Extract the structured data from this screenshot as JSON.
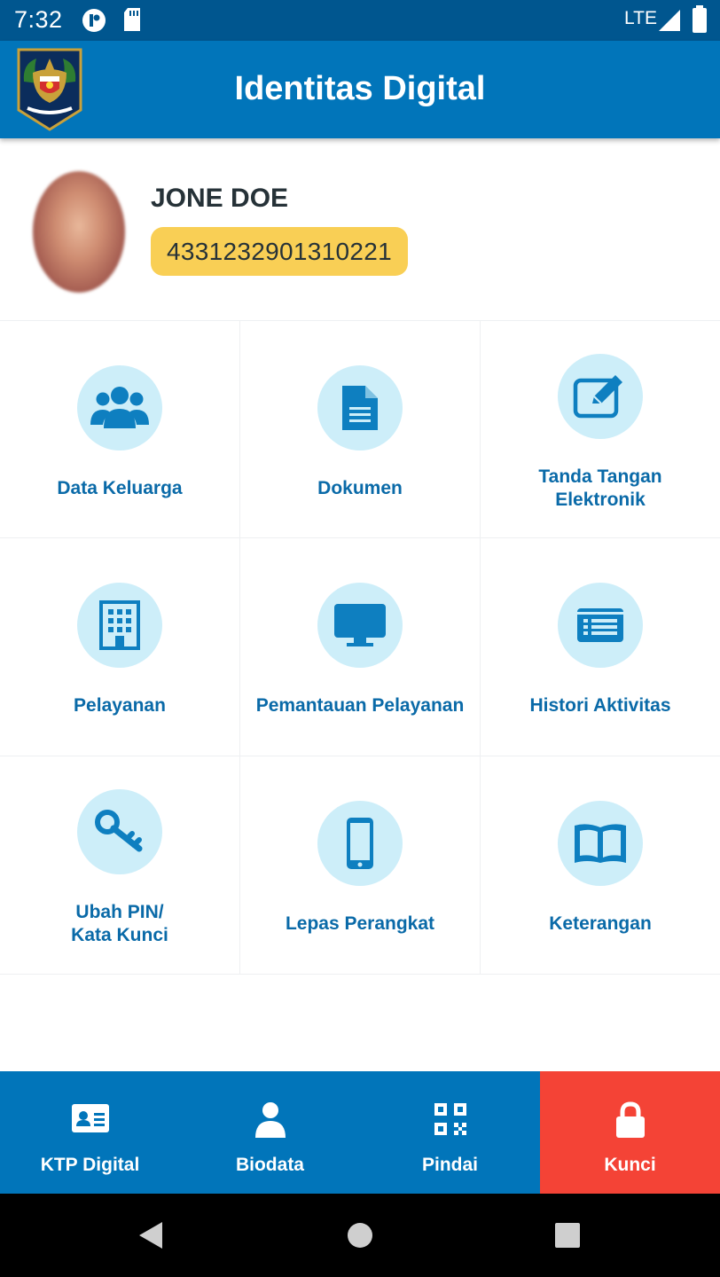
{
  "status_bar": {
    "time": "7:32",
    "network": "LTE"
  },
  "app_bar": {
    "title": "Identitas Digital",
    "logo_icon": "garuda-emblem-icon"
  },
  "profile": {
    "name": "JONE DOE",
    "nik": "4331232901310221"
  },
  "menu": {
    "items": [
      {
        "label": "Data Keluarga",
        "icon": "users-icon"
      },
      {
        "label": "Dokumen",
        "icon": "document-icon"
      },
      {
        "label": "Tanda Tangan\nElektronik",
        "icon": "edit-icon"
      },
      {
        "label": "Pelayanan",
        "icon": "building-icon"
      },
      {
        "label": "Pemantauan Pelayanan",
        "icon": "monitor-icon"
      },
      {
        "label": "Histori Aktivitas",
        "icon": "list-icon"
      },
      {
        "label": "Ubah PIN/\nKata Kunci",
        "icon": "key-icon"
      },
      {
        "label": "Lepas Perangkat",
        "icon": "phone-icon"
      },
      {
        "label": "Keterangan",
        "icon": "book-icon"
      }
    ]
  },
  "bottom_nav": {
    "items": [
      {
        "label": "KTP Digital",
        "icon": "id-card-icon"
      },
      {
        "label": "Biodata",
        "icon": "person-icon"
      },
      {
        "label": "Pindai",
        "icon": "qr-code-icon"
      },
      {
        "label": "Kunci",
        "icon": "lock-icon"
      }
    ],
    "active_color": "#f44336"
  },
  "colors": {
    "primary": "#0175ba",
    "status_bar": "#00568f",
    "icon_bg": "#cdeef9",
    "icon_fg": "#0e7fc0",
    "badge": "#f9cf55"
  }
}
